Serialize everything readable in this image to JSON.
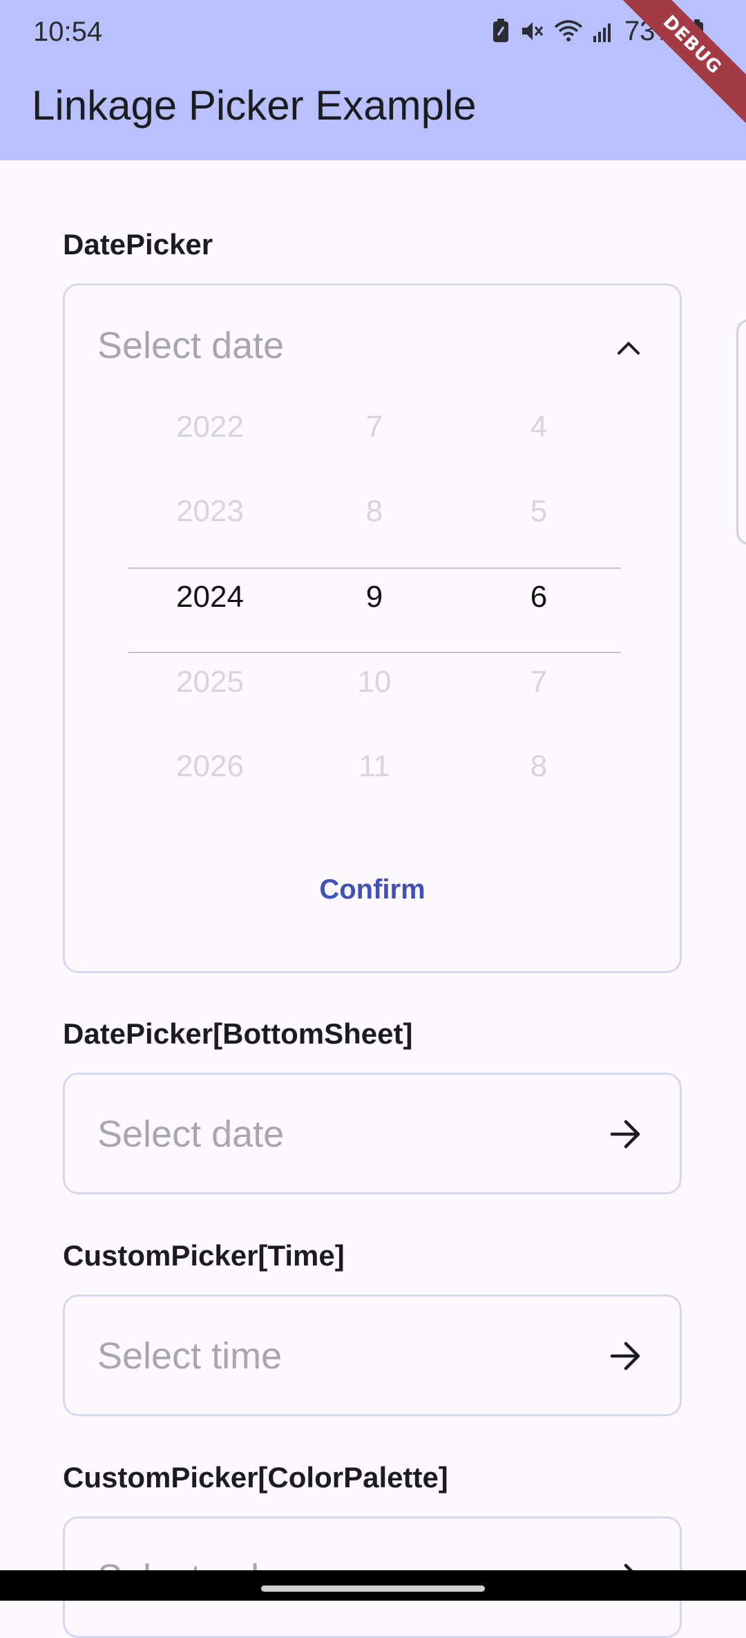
{
  "status_bar": {
    "time": "10:54",
    "battery": "73%",
    "icons": [
      "battery-saver-icon",
      "mute-icon",
      "wifi-icon",
      "signal-icon",
      "battery-icon"
    ]
  },
  "app_bar": {
    "title": "Linkage Picker Example",
    "debug_banner": "DEBUG"
  },
  "sections": {
    "date_picker": {
      "label": "DatePicker",
      "placeholder": "Select date",
      "expanded": true,
      "wheel": {
        "years": [
          "2022",
          "2023",
          "2024",
          "2025",
          "2026"
        ],
        "months": [
          "7",
          "8",
          "9",
          "10",
          "11"
        ],
        "days": [
          "4",
          "5",
          "6",
          "7",
          "8"
        ],
        "selected_index": 2
      },
      "confirm_label": "Confirm"
    },
    "date_picker_bottom_sheet": {
      "label": "DatePicker[BottomSheet]",
      "placeholder": "Select date"
    },
    "custom_picker_time": {
      "label": "CustomPicker[Time]",
      "placeholder": "Select time"
    },
    "custom_picker_color": {
      "label": "CustomPicker[ColorPalette]",
      "placeholder": "Select color"
    }
  },
  "colors": {
    "app_bar": "#b8c1fb",
    "background": "#fcf8fd",
    "accent": "#3f51b5",
    "card_border": "#d8d7f0",
    "debug_ribbon": "#a33a45"
  }
}
